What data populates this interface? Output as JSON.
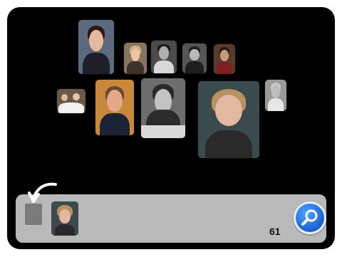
{
  "result_count": "61",
  "icons": {
    "return_arrow": "curved-arrow-icon",
    "search": "magnifier-icon"
  },
  "colors": {
    "stage_background": "#000000",
    "tray_background": "#b9b9b9",
    "search_button": "#1b5fd1"
  }
}
